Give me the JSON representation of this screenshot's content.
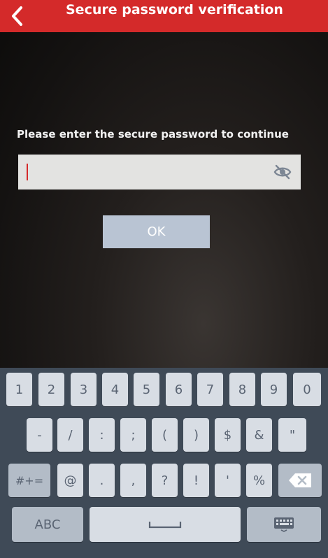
{
  "header": {
    "title": "Secure password verification",
    "back_icon": "chevron-left-icon",
    "color": "#d42a2a"
  },
  "prompt": "Please enter the secure password to continue",
  "password_field": {
    "value": "",
    "visibility_icon": "eye-off-icon"
  },
  "ok_button": {
    "label": "OK"
  },
  "keyboard": {
    "row1": [
      "1",
      "2",
      "3",
      "4",
      "5",
      "6",
      "7",
      "8",
      "9",
      "0"
    ],
    "row2": [
      "-",
      "/",
      ":",
      ";",
      "(",
      ")",
      "$",
      "&",
      "\""
    ],
    "row3": [
      "#+=",
      "@",
      ".",
      ",",
      "?",
      "!",
      "'",
      "%"
    ],
    "backspace_icon": "backspace-icon",
    "abc_label": "ABC",
    "space_icon": "space-bar-icon",
    "hide_keyboard_icon": "keyboard-icon"
  }
}
